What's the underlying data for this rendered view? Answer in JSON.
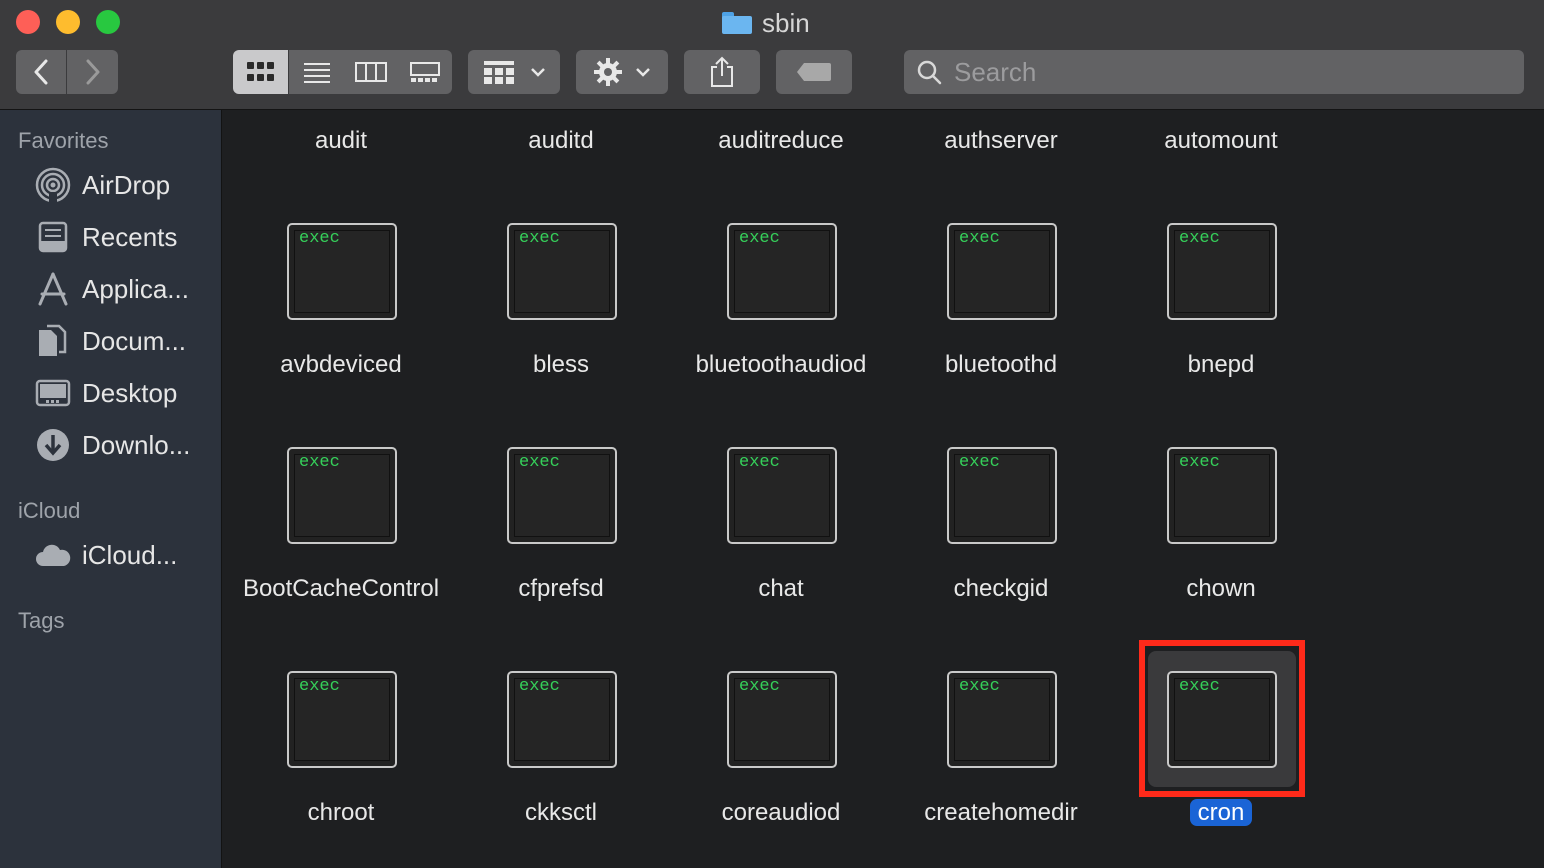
{
  "window": {
    "title": "sbin"
  },
  "toolbar": {
    "search_placeholder": "Search"
  },
  "sidebar": {
    "sections": [
      {
        "label": "Favorites",
        "items": [
          {
            "label": "AirDrop",
            "icon": "airdrop-icon"
          },
          {
            "label": "Recents",
            "icon": "recents-icon"
          },
          {
            "label": "Applica...",
            "icon": "applications-icon"
          },
          {
            "label": "Docum...",
            "icon": "documents-icon"
          },
          {
            "label": "Desktop",
            "icon": "desktop-icon"
          },
          {
            "label": "Downlo...",
            "icon": "downloads-icon"
          }
        ]
      },
      {
        "label": "iCloud",
        "items": [
          {
            "label": "iCloud...",
            "icon": "icloud-icon"
          }
        ]
      },
      {
        "label": "Tags",
        "items": []
      }
    ]
  },
  "files": {
    "icon_label": "exec",
    "top_row": [
      "audit",
      "auditd",
      "auditreduce",
      "authserver",
      "automount"
    ],
    "rows": [
      [
        "avbdeviced",
        "bless",
        "bluetoothaudiod",
        "bluetoothd",
        "bnepd"
      ],
      [
        "BootCacheControl",
        "cfprefsd",
        "chat",
        "checkgid",
        "chown"
      ],
      [
        "chroot",
        "ckksctl",
        "coreaudiod",
        "createhomedir",
        "cron"
      ]
    ],
    "selected": "cron"
  },
  "colors": {
    "accent": "#1a64d6",
    "highlight_border": "#ff2a1a",
    "exec_text": "#35d05a"
  }
}
